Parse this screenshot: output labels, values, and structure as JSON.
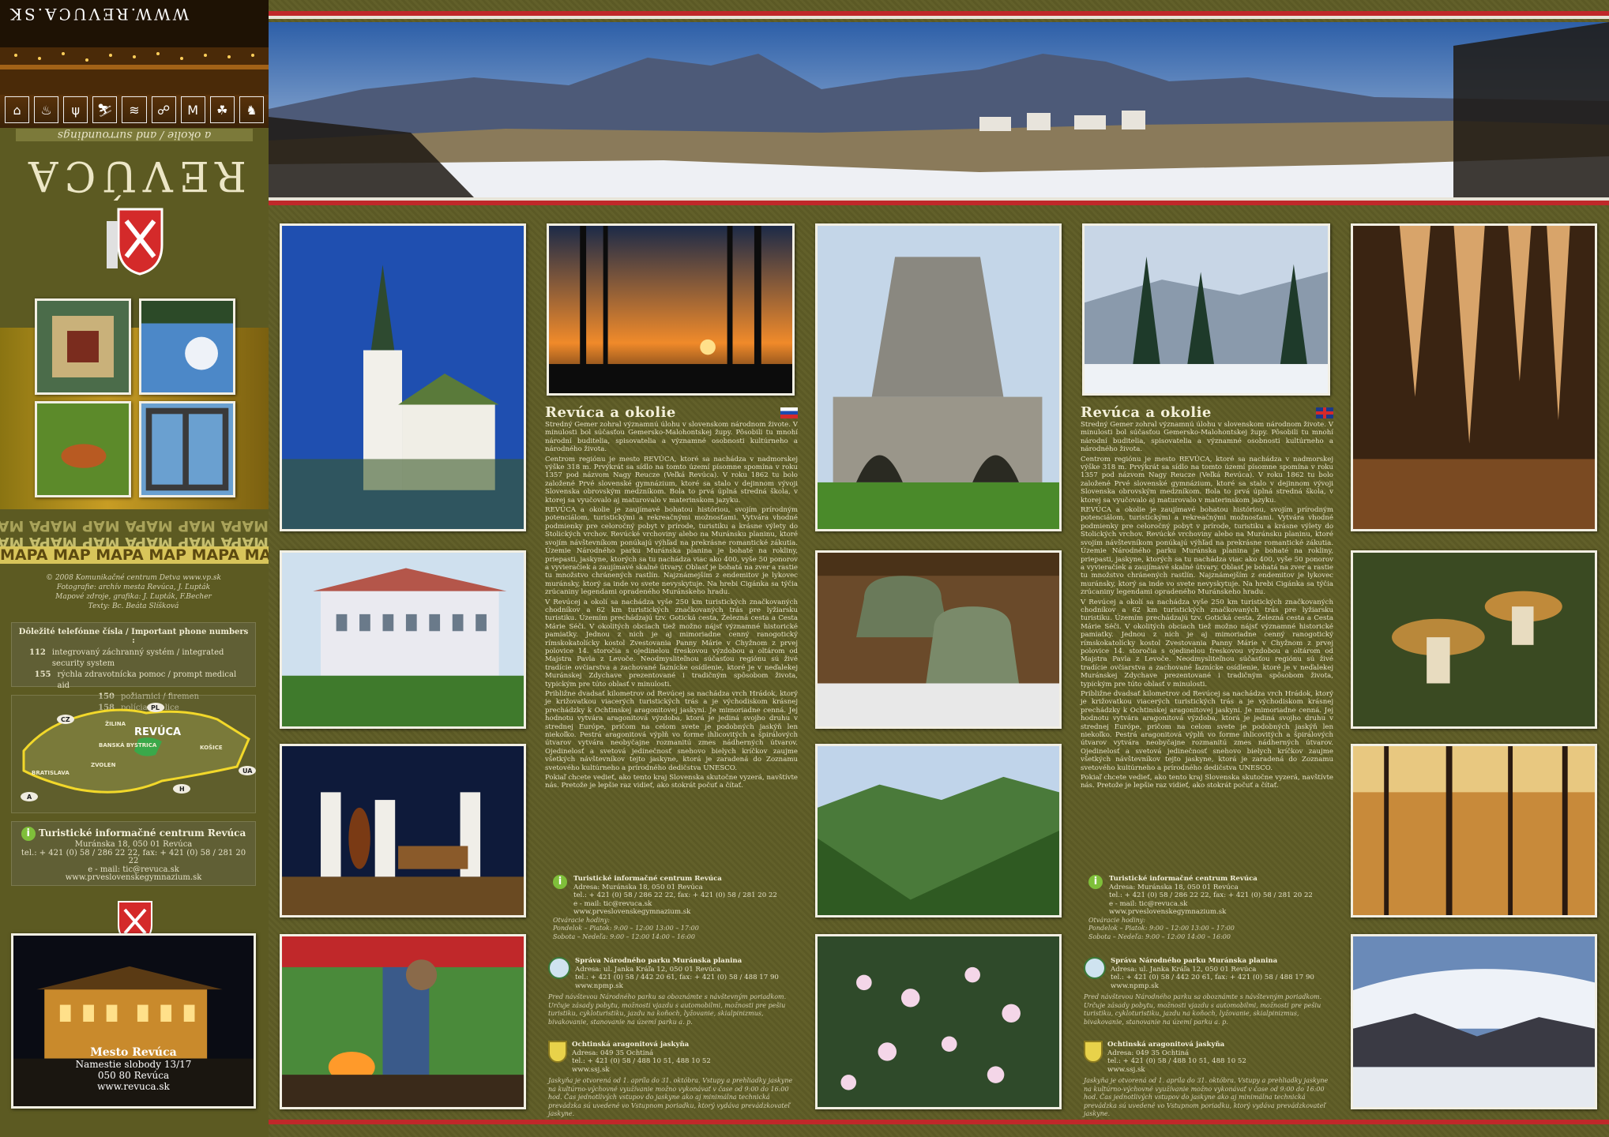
{
  "left": {
    "website_top": "WWW.REVUCA.SK",
    "subtitle": "a okolie / and surroundings",
    "title": "REVÚCA",
    "icons": [
      "bed-icon",
      "restaurant-icon",
      "fork-icon",
      "ski-icon",
      "bath-icon",
      "tennis-icon",
      "museum-icon",
      "cave-icon",
      "horse-icon"
    ],
    "mapa_text": "MAPA MAP MAPA MAP MAPA MAP MAPA",
    "credits": [
      "© 2008  Komunikačné centrum Detva   www.vp.sk",
      "Fotografie: archív mesta Revúca, J. Ľupták",
      "Mapové zdroje, grafika: J. Ľupták, F.Becher",
      "Texty: Bc. Beáta Slíšková"
    ],
    "phones_title": "Dôležité telefónne čísla / Important phone numbers :",
    "phones": [
      {
        "n": "112",
        "t": "integrovaný záchranný systém / integrated security system"
      },
      {
        "n": "155",
        "t": "rýchla zdravotnícka pomoc / prompt medical aid"
      },
      {
        "n": "150",
        "t": "požiarnici / firemen"
      },
      {
        "n": "158",
        "t": "polícia / police"
      }
    ],
    "map": {
      "city": "REVÚCA",
      "countries": [
        "CZ",
        "PL",
        "UA",
        "H",
        "A"
      ],
      "towns": [
        "BANSKÁ BYSTRICA",
        "ŽILINA",
        "KOŠICE",
        "ZVOLEN",
        "BRATISLAVA"
      ]
    },
    "tic": {
      "title": "Turistické informačné centrum Revúca",
      "address": "Muránska 18, 050 01 Revúca",
      "phone": "tel.: + 421 (0) 58 / 286 22 22, fax: + 421 (0) 58 / 281 20 22",
      "email": "e - mail: tic@revuca.sk",
      "web": "www.prveslovenskegymnazium.sk"
    },
    "city": {
      "title": "Mesto Revúca",
      "address": "Namestie slobody 13/17",
      "zip": "050 80  Revúca",
      "web": "www.revuca.sk"
    }
  },
  "columns": [
    {
      "title": "Revúca a okolie",
      "flag": "SK",
      "paragraphs": [
        "Stredný Gemer zohral významnú úlohu v slovenskom národnom živote. V minulosti bol súčasťou Gemersko-Malohontskej župy. Pôsobili tu mnohí národní buditelia, spisovatelia a významné osobnosti kultúrneho a národného života.",
        "Centrom regiónu je mesto REVÚCA, ktoré sa nachádza v nadmorskej výške 318 m. Prvýkrát sa sídlo na tomto území písomne spomína v roku 1357 pod názvom Nagy Reucze (Veľká Revúca). V roku 1862 tu bolo založené Prvé slovenské gymnázium, ktoré sa stalo v dejinnom vývoji Slovenska obrovským medzníkom. Bola to prvá úplná stredná škola, v ktorej sa vyučovalo aj maturovalo v materinskom jazyku.",
        "REVÚCA a okolie je zaujímavé bohatou históriou, svojím prírodným potenciálom, turistickými a rekreačnými možnosťami. Vytvára vhodné podmienky pre celoročný pobyt v prírode, turistiku a krásne výlety do Stolických vrchov. Revúcké vrchoviny alebo na Muránsku planinu, ktoré svojím návštevníkom ponúkajú výhľad na prekrásne romantické zákutia. Územie Národného parku Muránska planina je bohaté na rokliny, priepasti, jaskyne, ktorých sa tu nachádza viac ako 400, vyše 50 ponorov a vyvieračiek a zaujímavé skalné útvary. Oblasť je bohatá na zver a rastie tu množstvo chránených rastlín. Najznámejším z endemitov je lykovec muránsky, ktorý sa inde vo svete nevyskytuje. Na hrebi Cigánka sa týčia zrúcaniny legendami opradeného Muránskeho hradu.",
        "V Revúcej a okolí sa nachádza vyše 250 km turistických značkovaných chodníkov a 62 km turistických značkovaných trás pre lyžiarsku turistiku. Územím prechádzajú tzv. Gotická cesta, Železná cesta a Cesta Márie Séči. V okolitých obciach tiež možno nájsť významné historické pamiatky. Jednou z nich je aj mimoriadne cenný ranogotický rímskokatolícky kostol Zvestovania Panny Márie v Chyžnom z prvej polovice 14. storočia s ojedinelou freskovou výzdobou a oltárom od Majstra Pavla z Levoče. Neodmysliteľnou súčasťou regiónu sú živé tradície ovčiarstva a zachované ľaznícke osídlenie, ktoré je v neďalekej Muránskej Zdychave prezentované i tradičným spôsobom života, typickým pre túto oblasť v minulosti.",
        "Približne dvadsať kilometrov od Revúcej sa nachádza vrch Hrádok, ktorý je križovatkou viacerých turistických trás a je východiskom krásnej prechádzky k Ochtinskej aragonitovej jaskyni. Je mimoriadne cenná. Jej hodnotu vytvára aragonitová výzdoba, ktorá je jediná svojho druhu v strednej Európe, pričom na celom svete je podobných jaskýň len niekoľko. Pestrá aragonitová výplň vo forme ihlicovitých a špirálových útvarov vytvára neobyčajne rozmanitú zmes nádherných útvarov. Ojedinelosť a svetová jedinečnosť snehovo bielych kríčkov zaujme všetkých návštevníkov tejto jaskyne, ktorá je zaradená do Zoznamu svetového kultúrneho a prírodného dedičstva UNESCO.",
        "Pokiaľ chcete vedieť, ako tento kraj Slovenska skutočne vyzerá, navštívte nás. Pretože je lepšie raz vidieť, ako stokrát počuť a čítať."
      ],
      "tic": {
        "title": "Turistické informačné centrum Revúca",
        "lines": [
          "Adresa: Muránska 18, 050 01 Revúca",
          "tel.: + 421 (0) 58 / 286 22 22, fax: + 421 (0) 58 / 281 20 22",
          "e - mail: tic@revuca.sk",
          "www.prveslovenskegymnazium.sk"
        ]
      },
      "hours": {
        "label": "Otváracie hodiny:",
        "rows": [
          "Pondelok – Piatok:   9:00 – 12:00     13:00 – 17:00",
          "Sobota – Nedeľa:    9:00 – 12:00     14:00 – 16:00"
        ]
      },
      "np": {
        "title": "Správa Národného parku Muránska planina",
        "lines": [
          "Adresa: ul. Janka Kráľa 12, 050 01 Revúca",
          "tel.: + 421 (0) 58 / 442 20 61, fax: + 421 (0) 58 / 488 17 90",
          "www.npmp.sk"
        ],
        "note": "Pred návštevou Národného parku sa oboznámte s návštevným poriadkom. Určuje zásady pobytu, možnosti vjazdu s automobilmi, možnosti pre pešiu turistiku, cykloturistiku, jazdu na koňoch, lyžovanie, skialpinizmus, bivakovanie, stanovanie na území parku a. p."
      },
      "cave": {
        "title": "Ochtinská aragonitová jaskyňa",
        "lines": [
          "Adresa: 049 35 Ochtiná",
          "tel.: + 421 (0) 58 / 488 10 51,  488 10 52",
          "www.ssj.sk"
        ],
        "note": "Jaskyňa je otvorená od 1. apríla do 31. októbra. Vstupy a prehliadky jaskyne na kultúrno-výchovné využívanie možno vykonávať v čase od 9:00 do 16:00 hod. Čas jednotlivých vstupov do jaskyne ako aj minimálna technická prevádzka sú uvedené vo Vstupnom poriadku, ktorý vydáva prevádzkovateľ jaskyne."
      }
    },
    {
      "title": "Revúca a okolie",
      "flag": "GB",
      "paragraphs": [
        "Stredný Gemer zohral významnú úlohu v slovenskom národnom živote. V minulosti bol súčasťou Gemersko-Malohontskej župy. Pôsobili tu mnohí národní buditelia, spisovatelia a významné osobnosti kultúrneho a národného života.",
        "Centrom regiónu je mesto REVÚCA, ktoré sa nachádza v nadmorskej výške 318 m. Prvýkrát sa sídlo na tomto území písomne spomína v roku 1357 pod názvom Nagy Reucze (Veľká Revúca). V roku 1862 tu bolo založené Prvé slovenské gymnázium, ktoré sa stalo v dejinnom vývoji Slovenska obrovským medzníkom. Bola to prvá úplná stredná škola, v ktorej sa vyučovalo aj maturovalo v materinskom jazyku.",
        "REVÚCA a okolie je zaujímavé bohatou históriou, svojím prírodným potenciálom, turistickými a rekreačnými možnosťami. Vytvára vhodné podmienky pre celoročný pobyt v prírode, turistiku a krásne výlety do Stolických vrchov. Revúcké vrchoviny alebo na Muránsku planinu, ktoré svojím návštevníkom ponúkajú výhľad na prekrásne romantické zákutia. Územie Národného parku Muránska planina je bohaté na rokliny, priepasti, jaskyne, ktorých sa tu nachádza viac ako 400, vyše 50 ponorov a vyvieračiek a zaujímavé skalné útvary. Oblasť je bohatá na zver a rastie tu množstvo chránených rastlín. Najznámejším z endemitov je lykovec muránsky, ktorý sa inde vo svete nevyskytuje. Na hrebi Cigánka sa týčia zrúcaniny legendami opradeného Muránskeho hradu.",
        "V Revúcej a okolí sa nachádza vyše 250 km turistických značkovaných chodníkov a 62 km turistických značkovaných trás pre lyžiarsku turistiku. Územím prechádzajú tzv. Gotická cesta, Železná cesta a Cesta Márie Séči. V okolitých obciach tiež možno nájsť významné historické pamiatky. Jednou z nich je aj mimoriadne cenný ranogotický rímskokatolícky kostol Zvestovania Panny Márie v Chyžnom z prvej polovice 14. storočia s ojedinelou freskovou výzdobou a oltárom od Majstra Pavla z Levoče. Neodmysliteľnou súčasťou regiónu sú živé tradície ovčiarstva a zachované ľaznícke osídlenie, ktoré je v neďalekej Muránskej Zdychave prezentované i tradičným spôsobom života, typickým pre túto oblasť v minulosti.",
        "Približne dvadsať kilometrov od Revúcej sa nachádza vrch Hrádok, ktorý je križovatkou viacerých turistických trás a je východiskom krásnej prechádzky k Ochtinskej aragonitovej jaskyni. Je mimoriadne cenná. Jej hodnotu vytvára aragonitová výzdoba, ktorá je jediná svojho druhu v strednej Európe, pričom na celom svete je podobných jaskýň len niekoľko. Pestrá aragonitová výplň vo forme ihlicovitých a špirálových útvarov vytvára neobyčajne rozmanitú zmes nádherných útvarov. Ojedinelosť a svetová jedinečnosť snehovo bielych kríčkov zaujme všetkých návštevníkov tejto jaskyne, ktorá je zaradená do Zoznamu svetového kultúrneho a prírodného dedičstva UNESCO.",
        "Pokiaľ chcete vedieť, ako tento kraj Slovenska skutočne vyzerá, navštívte nás. Pretože je lepšie raz vidieť, ako stokrát počuť a čítať."
      ],
      "tic": {
        "title": "Turistické informačné centrum Revúca",
        "lines": [
          "Adresa: Muránska 18, 050 01 Revúca",
          "tel.: + 421 (0) 58 / 286 22 22, fax: + 421 (0) 58 / 281 20 22",
          "e - mail: tic@revuca.sk",
          "www.prveslovenskegymnazium.sk"
        ]
      },
      "hours": {
        "label": "Otváracie hodiny:",
        "rows": [
          "Pondelok – Piatok:   9:00 – 12:00     13:00 – 17:00",
          "Sobota – Nedeľa:    9:00 – 12:00     14:00 – 16:00"
        ]
      },
      "np": {
        "title": "Správa Národného parku Muránska planina",
        "lines": [
          "Adresa: ul. Janka Kráľa 12, 050 01 Revúca",
          "tel.: + 421 (0) 58 / 442 20 61, fax: + 421 (0) 58 / 488 17 90",
          "www.npmp.sk"
        ],
        "note": "Pred návštevou Národného parku sa oboznámte s návštevným poriadkom. Určuje zásady pobytu, možnosti vjazdu s automobilmi, možnosti pre pešiu turistiku, cykloturistiku, jazdu na koňoch, lyžovanie, skialpinizmus, bivakovanie, stanovanie na území parku a. p."
      },
      "cave": {
        "title": "Ochtinská aragonitová jaskyňa",
        "lines": [
          "Adresa: 049 35 Ochtiná",
          "tel.: + 421 (0) 58 / 488 10 51,  488 10 52",
          "www.ssj.sk"
        ],
        "note": "Jaskyňa je otvorená od 1. apríla do 31. októbra. Vstupy a prehliadky jaskyne na kultúrno-výchovné využívanie možno vykonávať v čase od 9:00 do 16:00 hod. Čas jednotlivých vstupov do jaskyne ako aj minimálna technická prevádzka sú uvedené vo Vstupnom poriadku, ktorý vydáva prevádzkovateľ jaskyne."
      }
    }
  ],
  "colors": {
    "accent_red": "#c0282a",
    "frame": "#f2efe3",
    "background": "#5c5a22",
    "text": "#e8e4c8"
  }
}
